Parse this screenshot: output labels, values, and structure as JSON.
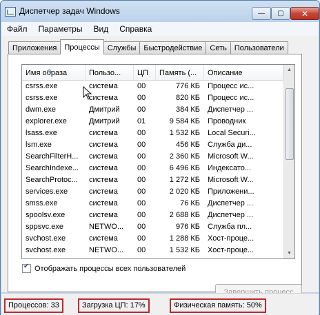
{
  "window": {
    "title": "Диспетчер задач Windows",
    "minimize_glyph": "—",
    "maximize_glyph": "▢",
    "close_glyph": "✕"
  },
  "menu": [
    "Файл",
    "Параметры",
    "Вид",
    "Справка"
  ],
  "tabs": [
    "Приложения",
    "Процессы",
    "Службы",
    "Быстродействие",
    "Сеть",
    "Пользователи"
  ],
  "active_tab": "Процессы",
  "columns": [
    "Имя образа",
    "Пользо...",
    "ЦП",
    "Память (...",
    "Описание"
  ],
  "sorted_column": "Имя образа",
  "rows": [
    [
      "csrss.exe",
      "система",
      "00",
      "776 КБ",
      "Процесс ис..."
    ],
    [
      "csrss.exe",
      "система",
      "00",
      "820 КБ",
      "Процесс ис..."
    ],
    [
      "dwm.exe",
      "Дмитрий",
      "00",
      "384 КБ",
      "Диспетчер ..."
    ],
    [
      "explorer.exe",
      "Дмитрий",
      "01",
      "9 584 КБ",
      "Проводник"
    ],
    [
      "lsass.exe",
      "система",
      "00",
      "1 532 КБ",
      "Local Securi..."
    ],
    [
      "lsm.exe",
      "система",
      "00",
      "456 КБ",
      "Служба ди..."
    ],
    [
      "SearchFilterH...",
      "система",
      "00",
      "2 360 КБ",
      "Microsoft W..."
    ],
    [
      "SearchIndexe...",
      "система",
      "00",
      "6 496 КБ",
      "Индексато..."
    ],
    [
      "SearchProtoc...",
      "система",
      "00",
      "1 272 КБ",
      "Microsoft W..."
    ],
    [
      "services.exe",
      "система",
      "00",
      "2 020 КБ",
      "Приложени..."
    ],
    [
      "smss.exe",
      "система",
      "00",
      "76 КБ",
      "Диспетчер ..."
    ],
    [
      "spoolsv.exe",
      "система",
      "00",
      "2 688 КБ",
      "Диспетчер ..."
    ],
    [
      "sppsvc.exe",
      "NETWO...",
      "00",
      "976 КБ",
      "Служба пл..."
    ],
    [
      "svchost.exe",
      "система",
      "00",
      "1 288 КБ",
      "Хост-проце..."
    ],
    [
      "svchost.exe",
      "NETWO...",
      "00",
      "1 532 КБ",
      "Хост-проце..."
    ]
  ],
  "show_all_users_label": "Отображать процессы всех пользователей",
  "show_all_users_checked": true,
  "end_process_label": "Завершить процесс",
  "status": {
    "processes": "Процессов: 33",
    "cpu": "Загрузка ЦП: 17%",
    "memory": "Физическая память: 50%"
  },
  "icons": {
    "scroll_up": "▲",
    "scroll_down": "▼",
    "sort": "▲"
  },
  "colors": {
    "highlight_border": "#c0262a",
    "title_gradient": "#bcd3ec"
  }
}
